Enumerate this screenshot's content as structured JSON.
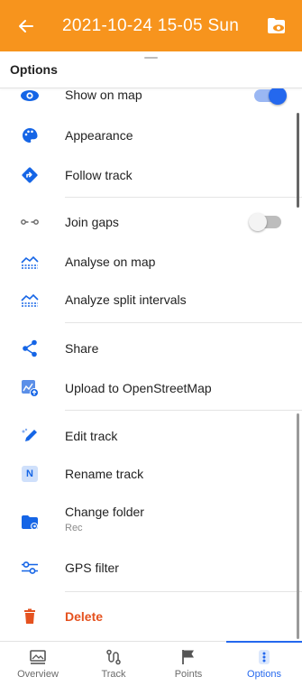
{
  "header": {
    "back_icon": "arrow-back-icon",
    "title": "2021-10-24 15-05 Sun",
    "folder_icon": "folder-eye-icon",
    "bg_color": "#f7941d"
  },
  "sheet": {
    "title": "Options"
  },
  "options": {
    "show_on_map": {
      "label": "Show on map",
      "enabled": true
    },
    "appearance": {
      "label": "Appearance"
    },
    "follow_track": {
      "label": "Follow track"
    },
    "join_gaps": {
      "label": "Join gaps",
      "enabled": false
    },
    "analyse_on_map": {
      "label": "Analyse on map"
    },
    "analyze_split": {
      "label": "Analyze split intervals"
    },
    "share": {
      "label": "Share"
    },
    "upload_osm": {
      "label": "Upload to OpenStreetMap"
    },
    "edit_track": {
      "label": "Edit track"
    },
    "rename_track": {
      "label": "Rename track",
      "icon_letter": "N"
    },
    "change_folder": {
      "label": "Change folder",
      "value": "Rec"
    },
    "gps_filter": {
      "label": "GPS filter"
    },
    "delete": {
      "label": "Delete",
      "color": "#e5521f"
    }
  },
  "bottom_nav": {
    "tabs": [
      {
        "label": "Overview",
        "icon": "overview-icon",
        "active": false
      },
      {
        "label": "Track",
        "icon": "track-icon",
        "active": false
      },
      {
        "label": "Points",
        "icon": "flag-icon",
        "active": false
      },
      {
        "label": "Options",
        "icon": "more-vertical-icon",
        "active": true
      }
    ]
  },
  "colors": {
    "accent": "#2468ee",
    "icon_blue": "#1565e6",
    "danger": "#e5521f"
  }
}
